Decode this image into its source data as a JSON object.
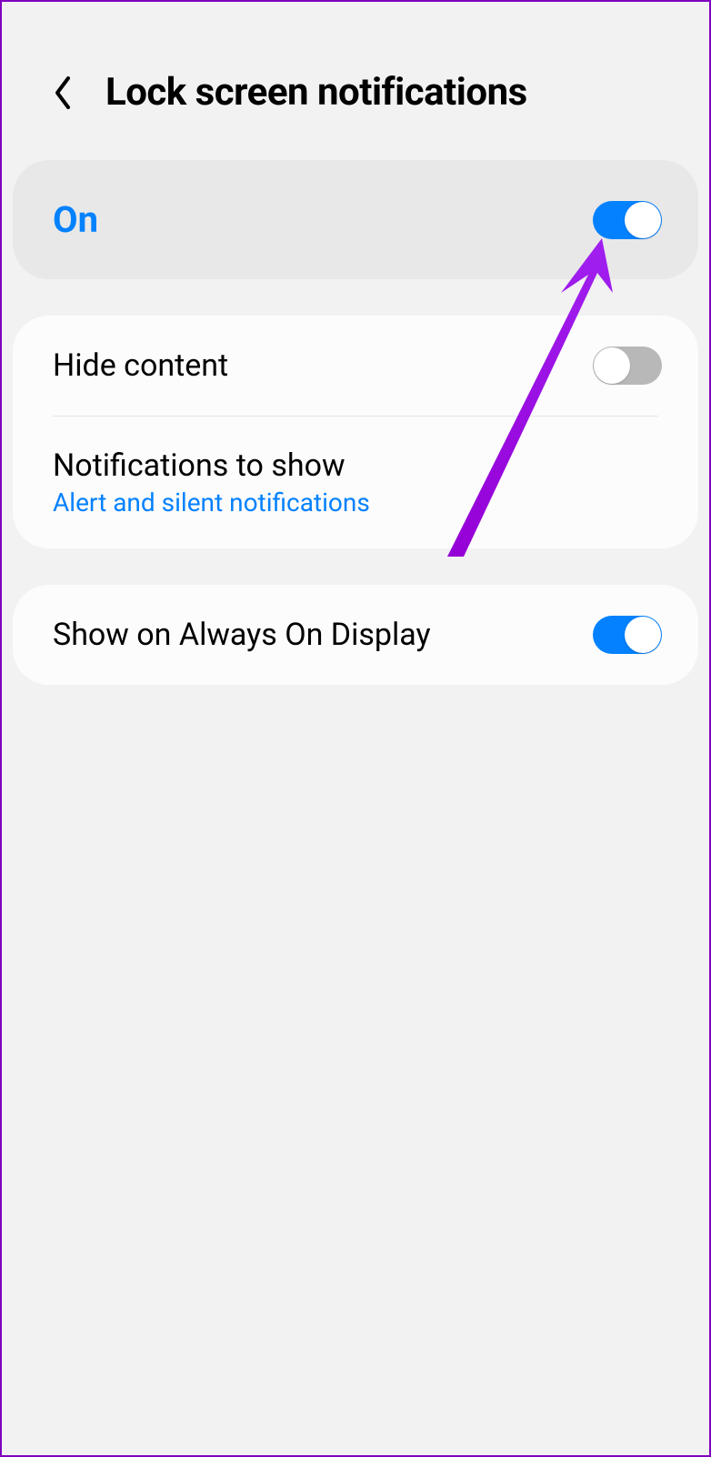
{
  "header": {
    "title": "Lock screen notifications"
  },
  "master": {
    "label": "On",
    "state": "on"
  },
  "group1": {
    "hide_content": {
      "label": "Hide content",
      "state": "off"
    },
    "notifications_to_show": {
      "label": "Notifications to show",
      "value": "Alert and silent notifications"
    }
  },
  "group2": {
    "aod": {
      "label": "Show on Always On Display",
      "state": "on"
    }
  }
}
